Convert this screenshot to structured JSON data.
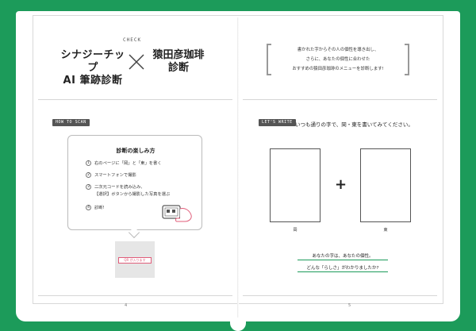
{
  "title_block": {
    "check_tag": "CHECK",
    "left_title_line1": "シナジーチップ",
    "left_title_line2": "AI 筆跡診断",
    "right_title_line1": "猿田彦珈琲",
    "right_title_line2": "診断"
  },
  "quote": {
    "line1": "書かれた字からその人の個性を導き出し、",
    "line2": "さらに、あなたの個性に合わせた",
    "line3": "おすすめの猿田彦珈琲のメニューを診断します!"
  },
  "left_page": {
    "tag": "HOW TO SCAN",
    "card_title": "診断の楽しみ方",
    "steps": [
      {
        "num": "1",
        "text": "右のページに「岡」と「東」を書く"
      },
      {
        "num": "2",
        "text": "スマートフォンで撮影"
      },
      {
        "num": "3",
        "text": "二次元コードを読み込み、"
      },
      {
        "num": "",
        "text": "【選択】ボタンから撮影した写真を選ぶ"
      },
      {
        "num": "4",
        "text": "診断!"
      }
    ],
    "qr_label": "QR が入ります",
    "page_number": "4"
  },
  "right_page": {
    "tag": "LET'S WRITE",
    "instruction": "いつも通りの字で、岡・東を書いてみてください。",
    "plus": "+",
    "box1_label": "岡",
    "box2_label": "東",
    "result_line1": "あなたの字は、あなたの個性。",
    "result_line2": "どんな「らしさ」がわかりましたか?",
    "page_number": "5"
  },
  "colors": {
    "frame_green": "#1c9b5a",
    "qr_pink": "#e05d7a"
  }
}
